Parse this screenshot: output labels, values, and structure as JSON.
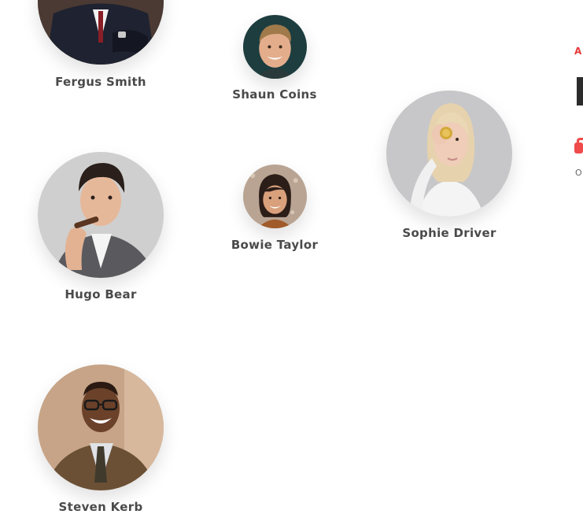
{
  "team": {
    "members": [
      {
        "name": "Fergus Smith"
      },
      {
        "name": "Shaun Coins"
      },
      {
        "name": "Sophie Driver"
      },
      {
        "name": "Hugo Bear"
      },
      {
        "name": "Bowie Taylor"
      },
      {
        "name": "Steven Kerb"
      }
    ]
  },
  "edge": {
    "accent_letter": "A",
    "small_text": "OI"
  },
  "colors": {
    "accent": "#e43838",
    "name_text": "#4a4a4a"
  }
}
